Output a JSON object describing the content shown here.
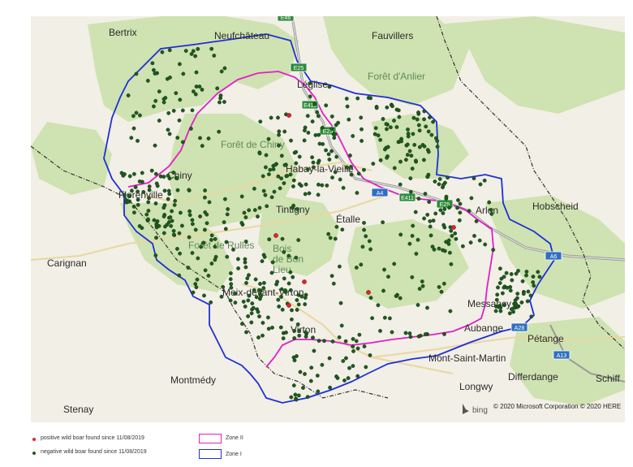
{
  "map": {
    "places": [
      {
        "name": "Bertrix",
        "kind": "town"
      },
      {
        "name": "Neufchâteau",
        "kind": "town"
      },
      {
        "name": "Fauvillers",
        "kind": "town"
      },
      {
        "name": "Forêt d'Anlier",
        "kind": "forest"
      },
      {
        "name": "Léglise",
        "kind": "town"
      },
      {
        "name": "Forêt de Chiny",
        "kind": "forest"
      },
      {
        "name": "Chiny",
        "kind": "town"
      },
      {
        "name": "Habay-la-Vieille",
        "kind": "town"
      },
      {
        "name": "Florenville",
        "kind": "town"
      },
      {
        "name": "Tintigny",
        "kind": "town"
      },
      {
        "name": "Étalle",
        "kind": "town"
      },
      {
        "name": "Arlon",
        "kind": "town"
      },
      {
        "name": "Hobscheid",
        "kind": "town"
      },
      {
        "name": "Carignan",
        "kind": "town"
      },
      {
        "name": "Forêt de Rulles",
        "kind": "forest"
      },
      {
        "name": "Bois de Bon Lieu",
        "kind": "forest"
      },
      {
        "name": "Meix-devant-Virton",
        "kind": "town"
      },
      {
        "name": "Messancy",
        "kind": "town"
      },
      {
        "name": "Virton",
        "kind": "town"
      },
      {
        "name": "Aubange",
        "kind": "town"
      },
      {
        "name": "Pétange",
        "kind": "town"
      },
      {
        "name": "Mont-Saint-Martin",
        "kind": "town"
      },
      {
        "name": "Montmédy",
        "kind": "town"
      },
      {
        "name": "Longwy",
        "kind": "town"
      },
      {
        "name": "Differdange",
        "kind": "town"
      },
      {
        "name": "Schiff",
        "kind": "town"
      },
      {
        "name": "Stenay",
        "kind": "town"
      }
    ],
    "road_shields": [
      "E46",
      "E25",
      "E411",
      "E25",
      "A4",
      "E411",
      "E25",
      "A6",
      "A13",
      "A28"
    ],
    "copyright": "© 2020 Microsoft Corporation © 2020 HERE",
    "bing_logo": "bing",
    "colors": {
      "zone1": "#1f2fd6",
      "zone2": "#e01fc8",
      "positive": "#d8262e",
      "negative": "#1f5a1f",
      "forest": "#cfe2b1",
      "land": "#f2efe6"
    }
  },
  "legend": {
    "positive_label": "positive wild boar found since 11/08/2019",
    "negative_label": "negative wild boar found since 11/08/2019",
    "zone2_label": "Zone II",
    "zone1_label": "Zone I"
  }
}
